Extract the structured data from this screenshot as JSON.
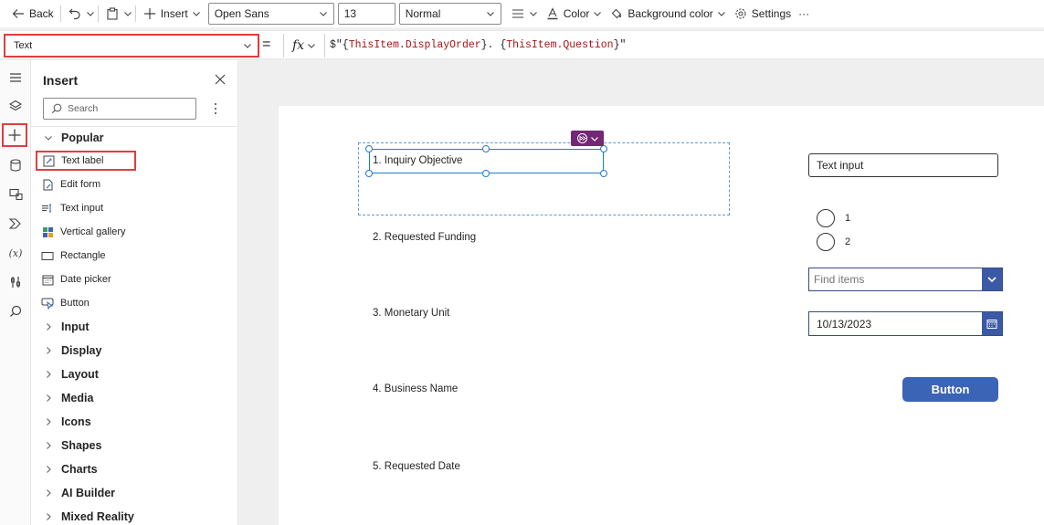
{
  "toolbar": {
    "back_label": "Back",
    "insert_label": "Insert",
    "font_value": "Open Sans",
    "font_size_value": "13",
    "weight_value": "Normal",
    "color_label": "Color",
    "background_color_label": "Background color",
    "settings_label": "Settings",
    "more_label": "···"
  },
  "formula_bar": {
    "property_value": "Text",
    "equals": "=",
    "fx_label": "fx",
    "formula_prefix": "$\"{",
    "formula_token1": "ThisItem.DisplayOrder",
    "formula_middle": "}. {",
    "formula_token2": "ThisItem.Question",
    "formula_suffix": "}\""
  },
  "left_rail": {
    "items": [
      {
        "name": "hamburger-icon"
      },
      {
        "name": "layers-icon"
      },
      {
        "name": "plus-icon"
      },
      {
        "name": "data-icon"
      },
      {
        "name": "media-icon"
      },
      {
        "name": "power-automate-icon"
      },
      {
        "name": "variables-icon",
        "text": "(x)"
      },
      {
        "name": "tools-icon"
      },
      {
        "name": "search-icon"
      }
    ]
  },
  "insert_panel": {
    "title": "Insert",
    "search_placeholder": "Search",
    "popular_label": "Popular",
    "popular_items": [
      {
        "label": "Text label",
        "icon": "text-label-icon"
      },
      {
        "label": "Edit form",
        "icon": "edit-form-icon"
      },
      {
        "label": "Text input",
        "icon": "text-input-icon"
      },
      {
        "label": "Vertical gallery",
        "icon": "gallery-icon"
      },
      {
        "label": "Rectangle",
        "icon": "rectangle-icon"
      },
      {
        "label": "Date picker",
        "icon": "calendar-icon"
      },
      {
        "label": "Button",
        "icon": "button-icon"
      }
    ],
    "categories": [
      "Input",
      "Display",
      "Layout",
      "Media",
      "Icons",
      "Shapes",
      "Charts",
      "AI Builder",
      "Mixed Reality"
    ]
  },
  "canvas": {
    "questions": [
      "1. Inquiry Objective",
      "2. Requested Funding",
      "3. Monetary Unit",
      "4. Business Name",
      "5. Requested Date"
    ],
    "text_input_value": "Text input",
    "radio_options": [
      "1",
      "2"
    ],
    "combo_placeholder": "Find items",
    "date_value": "10/13/2023",
    "button_label": "Button"
  },
  "colors": {
    "highlight": "#e03e3e",
    "selection": "#1e7bd6",
    "purple": "#742774",
    "control_blue": "#3b5aa6",
    "button_blue": "#3b63b6"
  }
}
